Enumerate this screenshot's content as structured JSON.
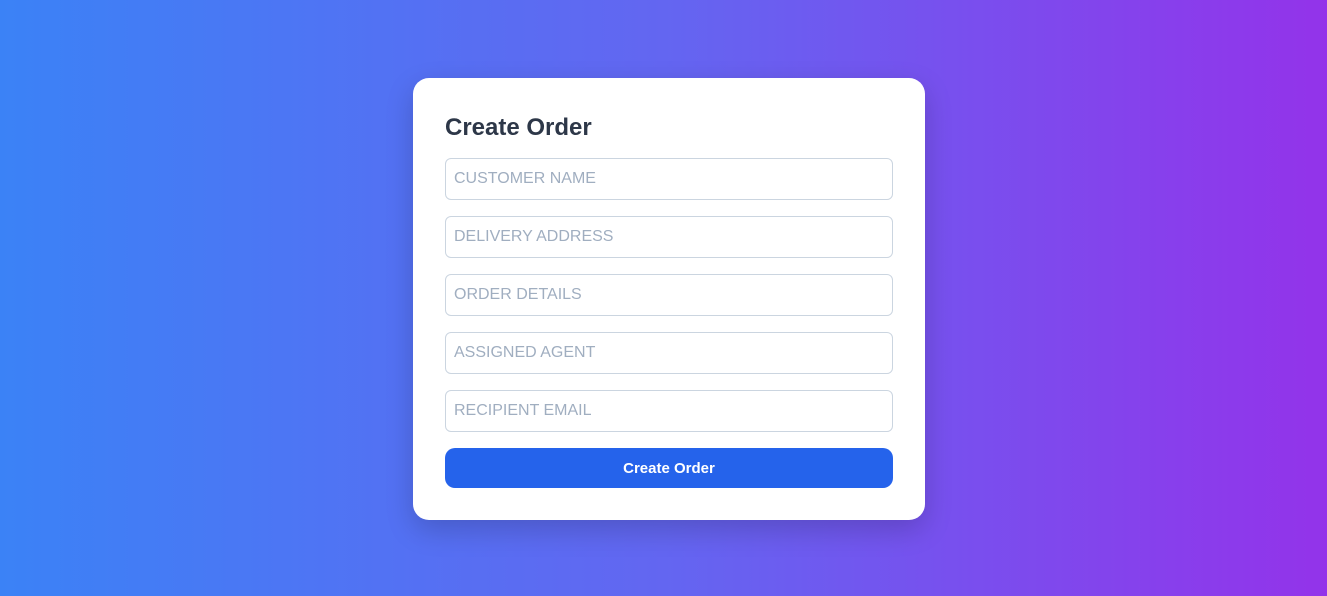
{
  "form": {
    "title": "Create Order",
    "fields": [
      {
        "name": "customer_name",
        "placeholder": "CUSTOMER NAME",
        "value": ""
      },
      {
        "name": "delivery_address",
        "placeholder": "DELIVERY ADDRESS",
        "value": ""
      },
      {
        "name": "order_details",
        "placeholder": "ORDER DETAILS",
        "value": ""
      },
      {
        "name": "assigned_agent",
        "placeholder": "ASSIGNED AGENT",
        "value": ""
      },
      {
        "name": "recipient_email",
        "placeholder": "RECIPIENT EMAIL",
        "value": ""
      }
    ],
    "submit_label": "Create Order"
  },
  "colors": {
    "gradient_start": "#3b82f6",
    "gradient_end": "#9333ea",
    "button": "#2563eb",
    "title_text": "#2d3748",
    "placeholder_text": "#a0aec0"
  }
}
